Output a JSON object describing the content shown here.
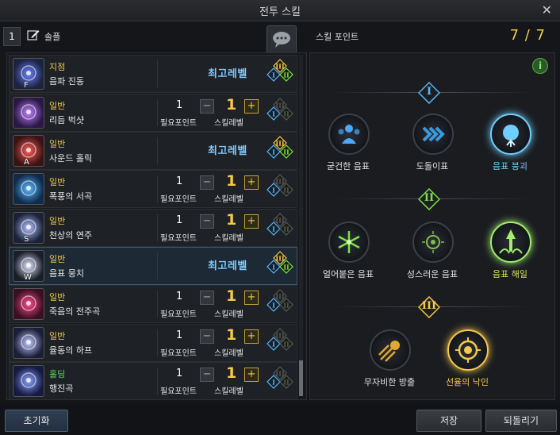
{
  "window": {
    "title": "전투 스킬",
    "close_icon": "close-icon"
  },
  "left_header": {
    "preset_number": "1",
    "preset_name": "솔플"
  },
  "skills": [
    {
      "type": "지점",
      "name": "음파 진동",
      "state": "max",
      "max_label": "최고레벨",
      "key": "F",
      "colors": [
        "#1b2340",
        "#6a80ff"
      ]
    },
    {
      "type": "일반",
      "name": "리듬 벅샷",
      "state": "points",
      "points": "1",
      "level": "1",
      "colors": [
        "#2a1745",
        "#c080ff"
      ]
    },
    {
      "type": "일반",
      "name": "사운드 홀릭",
      "state": "max",
      "max_label": "최고레벨",
      "key": "A",
      "colors": [
        "#3a1414",
        "#ff5a5a"
      ]
    },
    {
      "type": "일반",
      "name": "폭풍의 서곡",
      "state": "points",
      "points": "1",
      "level": "1",
      "colors": [
        "#0f2a4a",
        "#5ab8ff"
      ]
    },
    {
      "type": "일반",
      "name": "천상의 연주",
      "state": "points",
      "points": "1",
      "level": "1",
      "key": "S",
      "colors": [
        "#1a2238",
        "#b0c0ff"
      ]
    },
    {
      "type": "일반",
      "name": "음표 뭉치",
      "state": "max",
      "max_label": "최고레벨",
      "key": "W",
      "colors": [
        "#1a1e2a",
        "#dfe6ff"
      ],
      "selected": true
    },
    {
      "type": "일반",
      "name": "죽음의 전주곡",
      "state": "points",
      "points": "1",
      "level": "1",
      "colors": [
        "#3a0f22",
        "#ff4a8a"
      ]
    },
    {
      "type": "일반",
      "name": "율동의 하프",
      "state": "points",
      "points": "1",
      "level": "1",
      "colors": [
        "#1a1e38",
        "#c0c8ff"
      ]
    },
    {
      "type": "홀딩",
      "name": "행진곡",
      "state": "points",
      "points": "1",
      "level": "1",
      "colors": [
        "#151a40",
        "#8aa0ff"
      ],
      "green": true
    }
  ],
  "labels": {
    "points_label": "필요포인트",
    "level_label": "스킬레벨",
    "minus": "−",
    "plus": "+"
  },
  "right_header": {
    "skill_points_label": "스킬 포인트",
    "skill_points_value": "7 / 7"
  },
  "info_icon": "i",
  "tiers": [
    {
      "numeral": "I",
      "nodes": [
        {
          "name": "굳건한 음표",
          "selected": false,
          "icon": "group-icon",
          "color": "#4aa8ff"
        },
        {
          "name": "도돌이표",
          "selected": false,
          "icon": "chevron-arrows-icon",
          "color": "#3a9adf"
        },
        {
          "name": "음표 붕괴",
          "selected": true,
          "icon": "burst-icon",
          "color": "#6fd0ff"
        }
      ]
    },
    {
      "numeral": "II",
      "nodes": [
        {
          "name": "얼어붙은 음표",
          "selected": false,
          "icon": "snowflake-icon",
          "color": "#7fe04a"
        },
        {
          "name": "성스러운 음표",
          "selected": false,
          "icon": "sun-sigil-icon",
          "color": "#7fc04a"
        },
        {
          "name": "음표 해일",
          "selected": true,
          "icon": "wave-icon",
          "color": "#9ff06a"
        }
      ]
    },
    {
      "numeral": "III",
      "nodes": [
        {
          "name": "무자비한 방출",
          "selected": false,
          "icon": "comet-icon",
          "color": "#e0a830"
        },
        {
          "name": "선율의 낙인",
          "selected": true,
          "icon": "brand-icon",
          "color": "#f5c94b"
        }
      ]
    }
  ],
  "bottom": {
    "reset": "초기화",
    "save": "저장",
    "revert": "되돌리기"
  }
}
